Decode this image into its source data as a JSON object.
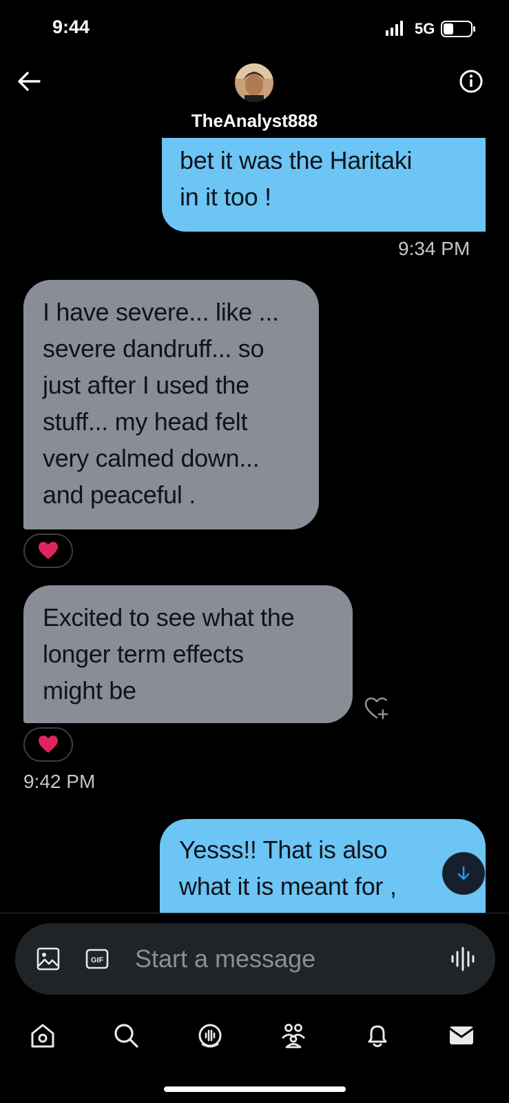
{
  "status_bar": {
    "time": "9:44",
    "network": "5G"
  },
  "header": {
    "username": "TheAnalyst888",
    "back_icon": "arrow-left-icon",
    "info_icon": "info-circle-icon"
  },
  "messages": [
    {
      "direction": "sent",
      "text": "bet it was the Haritaki\nin it too !"
    },
    {
      "direction": "received",
      "text": "I have severe... like ...\nsevere dandruff... so\njust after I used the\nstuff... my head felt\nvery calmed down...\nand peaceful .",
      "reaction": "heart"
    },
    {
      "direction": "received",
      "text": "Excited to see what the\nlonger term effects\nmight be",
      "reaction": "heart"
    },
    {
      "direction": "sent",
      "text": "Yesss!! That is also\nwhat it is meant for ,"
    }
  ],
  "timestamps": {
    "first": "9:34 PM",
    "second": "9:42 PM"
  },
  "composer": {
    "placeholder": "Start a message",
    "gif_label": "GIF",
    "media_icon": "image-icon",
    "voice_icon": "voice-wave-icon"
  },
  "nav": {
    "items": [
      "home-icon",
      "search-icon",
      "spaces-icon",
      "communities-icon",
      "notifications-icon",
      "messages-icon"
    ]
  },
  "colors": {
    "background": "#000000",
    "sent_bubble": "#6cc5f5",
    "received_bubble": "#898d96",
    "heart": "#e0245e"
  }
}
